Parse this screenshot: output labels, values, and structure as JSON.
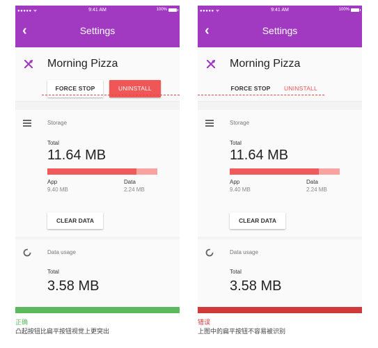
{
  "status_bar": {
    "signal": "●●●●● ᯤ",
    "time": "9:41 AM",
    "battery": "100%"
  },
  "nav": {
    "back": "‹",
    "title": "Settings"
  },
  "app": {
    "name": "Morning Pizza",
    "icon": "fork-knife-icon"
  },
  "buttons": {
    "force_stop": "FORCE STOP",
    "uninstall": "UNINSTALL",
    "clear_data": "CLEAR DATA"
  },
  "storage": {
    "section_label": "Storage",
    "total_label": "Total",
    "total_value": "11.64 MB",
    "app_label": "App",
    "app_value": "9.40 MB",
    "data_label": "Data",
    "data_value": "2.24 MB",
    "app_fraction": 0.808
  },
  "data_usage": {
    "section_label": "Data usage",
    "total_label": "Total",
    "total_value": "3.58 MB"
  },
  "captions": {
    "correct_tag": "正确",
    "correct_text": "凸起按钮比扁平按钮视觉上更突出",
    "wrong_tag": "错误",
    "wrong_text": "上图中的扁平按钮不容易被识别"
  },
  "colors": {
    "accent": "#a13ac0",
    "danger": "#f05656",
    "correct": "#5cb85c",
    "wrong": "#d03a3a"
  }
}
